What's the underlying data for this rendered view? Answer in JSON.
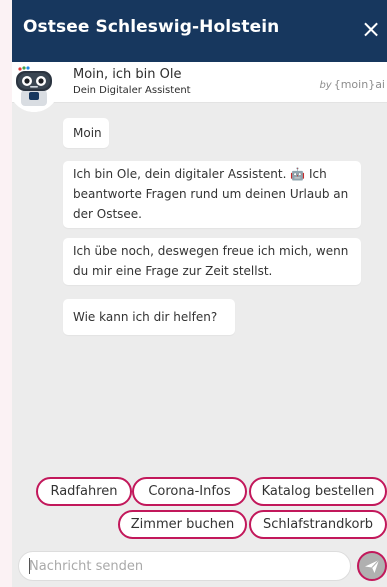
{
  "header": {
    "title": "Ostsee Schleswig-Holstein",
    "close_label": "×"
  },
  "bot": {
    "name": "Moin, ich bin Ole",
    "subtitle": "Dein Digitaler Assistent"
  },
  "powered_by": {
    "prefix": "by",
    "brand": "{moin}ai"
  },
  "messages": [
    {
      "text": "Moin"
    },
    {
      "text": "Ich bin Ole, dein digitaler Assistent. 🤖 Ich beantworte Fragen rund um deinen Urlaub an der Ostsee."
    },
    {
      "text": "Ich übe noch, deswegen freue ich mich, wenn du mir eine Frage zur Zeit stellst."
    },
    {
      "text": "Wie kann ich dir helfen?"
    }
  ],
  "quick_replies": [
    "Radfahren",
    "Corona-Infos",
    "Katalog bestellen",
    "Zimmer buchen",
    "Schlafstrandkorb"
  ],
  "input": {
    "placeholder": "Nachricht senden",
    "value": ""
  },
  "colors": {
    "header": "#17375e",
    "accent": "#c2185b",
    "background": "#ececec",
    "bubble": "#ffffff"
  },
  "icons": {
    "close": "close-icon",
    "send": "send-icon",
    "avatar": "robot-avatar-icon"
  }
}
